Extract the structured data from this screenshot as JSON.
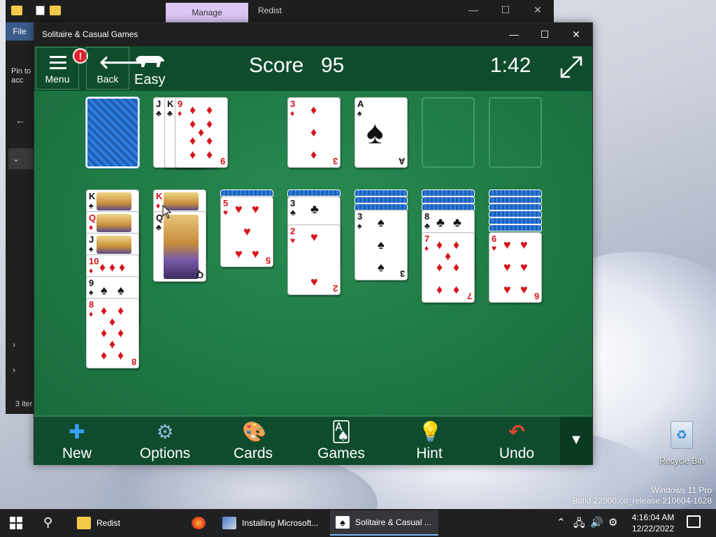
{
  "explorer": {
    "manage_tab": "Manage",
    "title": "Redist",
    "file_tab": "File",
    "pin_text": "Pin to acc",
    "status": "3 iter"
  },
  "window": {
    "title": "Solitaire & Casual Games",
    "minimize_glyph": "—",
    "maximize_glyph": "☐",
    "close_glyph": "✕"
  },
  "header": {
    "menu_label": "Menu",
    "alert_glyph": "!",
    "back_label": "Back",
    "back_glyph": "🡐",
    "difficulty": "Easy",
    "score_label": "Score",
    "score_value": "95",
    "timer": "1:42"
  },
  "board": {
    "stock": "card back",
    "waste": [
      {
        "rank": "J",
        "suit": "♣",
        "color": "black"
      },
      {
        "rank": "K",
        "suit": "♣",
        "color": "black"
      },
      {
        "rank": "9",
        "suit": "♦",
        "color": "red"
      }
    ],
    "foundations": [
      {
        "rank": "3",
        "suit": "♦",
        "color": "red"
      },
      {
        "rank": "A",
        "suit": "♠",
        "color": "black"
      },
      {
        "rank": "",
        "suit": "",
        "color": ""
      },
      {
        "rank": "",
        "suit": "",
        "color": ""
      }
    ],
    "tableau": [
      {
        "hidden": 0,
        "cards": [
          {
            "rank": "K",
            "suit": "♠",
            "color": "black"
          },
          {
            "rank": "Q",
            "suit": "♦",
            "color": "red"
          },
          {
            "rank": "J",
            "suit": "♠",
            "color": "black"
          },
          {
            "rank": "10",
            "suit": "♦",
            "color": "red"
          },
          {
            "rank": "9",
            "suit": "♠",
            "color": "black"
          },
          {
            "rank": "8",
            "suit": "♦",
            "color": "red"
          }
        ]
      },
      {
        "hidden": 0,
        "cards": [
          {
            "rank": "K",
            "suit": "♦",
            "color": "red"
          },
          {
            "rank": "Q",
            "suit": "♣",
            "color": "black"
          }
        ]
      },
      {
        "hidden": 1,
        "cards": [
          {
            "rank": "5",
            "suit": "♥",
            "color": "red"
          }
        ]
      },
      {
        "hidden": 1,
        "cards": [
          {
            "rank": "3",
            "suit": "♣",
            "color": "black"
          },
          {
            "rank": "2",
            "suit": "♥",
            "color": "red"
          }
        ]
      },
      {
        "hidden": 3,
        "cards": [
          {
            "rank": "3",
            "suit": "♠",
            "color": "black"
          }
        ]
      },
      {
        "hidden": 4,
        "cards": [
          {
            "rank": "8",
            "suit": "♣",
            "color": "black"
          },
          {
            "rank": "7",
            "suit": "♦",
            "color": "red"
          }
        ]
      },
      {
        "hidden": 6,
        "cards": [
          {
            "rank": "6",
            "suit": "♥",
            "color": "red"
          }
        ]
      }
    ]
  },
  "toolbar": {
    "items": [
      {
        "label": "New",
        "icon": "plus-icon",
        "glyph": "✚",
        "color": "#3aa0ff"
      },
      {
        "label": "Options",
        "icon": "gear-icon",
        "glyph": "⚙",
        "color": "#8fb7d8"
      },
      {
        "label": "Cards",
        "icon": "palette-icon",
        "glyph": "🎨",
        "color": "#e0a050"
      },
      {
        "label": "Games",
        "icon": "cards-icon",
        "glyph": "🂡",
        "color": "#3a7be0"
      },
      {
        "label": "Hint",
        "icon": "lightbulb-icon",
        "glyph": "💡",
        "color": "#ffd83a"
      },
      {
        "label": "Undo",
        "icon": "undo-icon",
        "glyph": "↶",
        "color": "#e8473a"
      }
    ],
    "expand_glyph": "▼"
  },
  "desktop": {
    "recycle_bin": "Recycle Bin",
    "watermark_line1": "Windows 11 Pro",
    "watermark_line2": "Build 22000.co_release.210604-1628"
  },
  "taskbar": {
    "tasks": [
      {
        "label": "Redist",
        "icon": "folder-icon"
      },
      {
        "label": "",
        "icon": "firefox-icon"
      },
      {
        "label": "Installing Microsoft...",
        "icon": "installer-icon"
      },
      {
        "label": "Solitaire & Casual ...",
        "icon": "solitaire-icon"
      }
    ],
    "time": "4:16:04 AM",
    "date": "12/22/2022"
  },
  "colors": {
    "felt": "#1f7a45",
    "header": "#0f4c2e",
    "alert": "#e5202d"
  }
}
